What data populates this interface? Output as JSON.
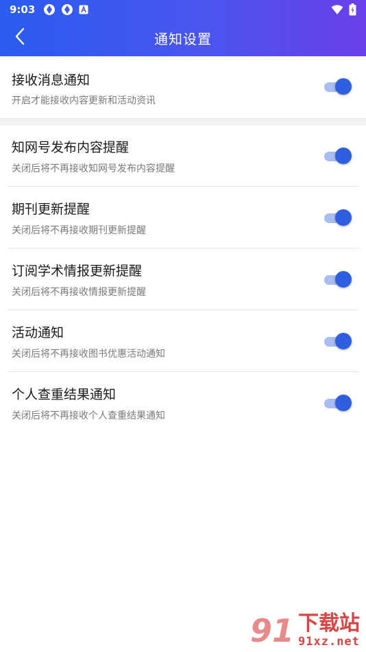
{
  "status_bar": {
    "time": "9:03",
    "icons_left": [
      "app-icon",
      "app-icon",
      "notification-a-icon"
    ],
    "icons_right": [
      "wifi-icon",
      "battery-charging-icon"
    ]
  },
  "header": {
    "title": "通知设置",
    "back_icon": "chevron-left-icon",
    "gradient_colors": [
      "#2b5cf0",
      "#6a3fea"
    ]
  },
  "main_setting": {
    "title": "接收消息通知",
    "subtitle": "开启才能接收内容更新和活动资讯",
    "enabled": true
  },
  "settings": [
    {
      "title": "知网号发布内容提醒",
      "subtitle": "关闭后将不再接收知网号发布内容提醒",
      "enabled": true
    },
    {
      "title": "期刊更新提醒",
      "subtitle": "关闭后将不再接收期刊更新提醒",
      "enabled": true
    },
    {
      "title": "订阅学术情报更新提醒",
      "subtitle": "关闭后将不再接收情报更新提醒",
      "enabled": true
    },
    {
      "title": "活动通知",
      "subtitle": "关闭后将不再接收图书优惠活动通知",
      "enabled": true
    },
    {
      "title": "个人查重结果通知",
      "subtitle": "关闭后将不再接收个人查重结果通知",
      "enabled": true
    }
  ],
  "toggle_colors": {
    "track": "#a9bdf3",
    "knob": "#2f5fe0"
  },
  "watermark": {
    "logo": "91",
    "text": "下载站",
    "url": "91xz.net"
  }
}
